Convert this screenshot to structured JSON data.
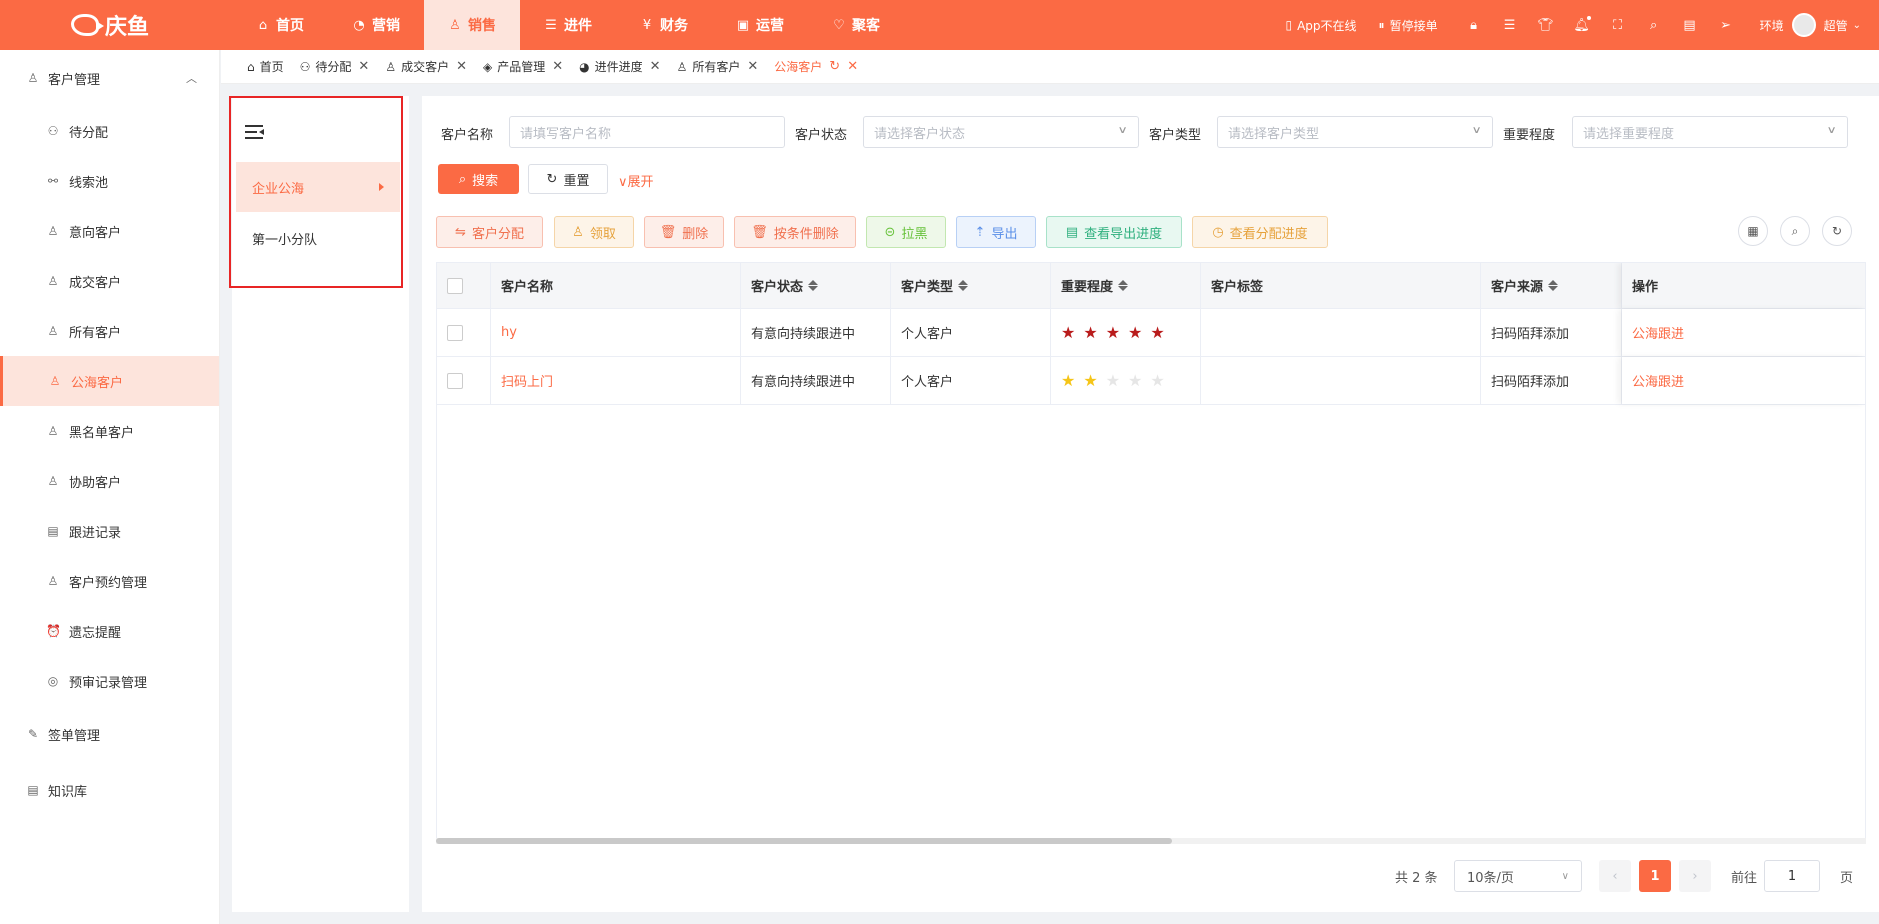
{
  "app": {
    "logo_text": "庆鱼"
  },
  "colors": {
    "accent": "#fb6a44",
    "star_red": "#b91c1c",
    "star_yellow": "#f5c518",
    "star_empty": "#e6e6e6"
  },
  "topnav": [
    {
      "label": "首页",
      "icon": "home-icon",
      "glyph": "⌂"
    },
    {
      "label": "营销",
      "icon": "marketing-icon",
      "glyph": "◔"
    },
    {
      "label": "销售",
      "icon": "sales-icon",
      "glyph": "♙",
      "active": true
    },
    {
      "label": "进件",
      "icon": "intake-icon",
      "glyph": "☰"
    },
    {
      "label": "财务",
      "icon": "finance-icon",
      "glyph": "¥"
    },
    {
      "label": "运营",
      "icon": "operations-icon",
      "glyph": "▣"
    },
    {
      "label": "聚客",
      "icon": "customers-icon",
      "glyph": "♡"
    }
  ],
  "topright": {
    "app_status": "App不在线",
    "pause": "暂停接单",
    "env": "环境",
    "user": "超管"
  },
  "sidebar": {
    "group1": "客户管理",
    "items": [
      {
        "label": "待分配",
        "icon": "sitemap-icon",
        "glyph": "⚇"
      },
      {
        "label": "线索池",
        "icon": "clue-icon",
        "glyph": "⚯"
      },
      {
        "label": "意向客户",
        "icon": "user-intent-icon",
        "glyph": "♙"
      },
      {
        "label": "成交客户",
        "icon": "user-deal-icon",
        "glyph": "♙"
      },
      {
        "label": "所有客户",
        "icon": "users-icon",
        "glyph": "♙"
      },
      {
        "label": "公海客户",
        "icon": "user-sea-icon",
        "glyph": "♙",
        "active": true
      },
      {
        "label": "黑名单客户",
        "icon": "user-block-icon",
        "glyph": "♙"
      },
      {
        "label": "协助客户",
        "icon": "user-assist-icon",
        "glyph": "♙"
      },
      {
        "label": "跟进记录",
        "icon": "record-icon",
        "glyph": "▤"
      },
      {
        "label": "客户预约管理",
        "icon": "appointment-icon",
        "glyph": "♙"
      },
      {
        "label": "遗忘提醒",
        "icon": "alarm-icon",
        "glyph": "⏰"
      },
      {
        "label": "预审记录管理",
        "icon": "review-icon",
        "glyph": "◎"
      }
    ],
    "group2": "签单管理",
    "group3": "知识库"
  },
  "tabs": [
    {
      "label": "首页",
      "icon": "home-icon",
      "glyph": "⌂",
      "closable": false
    },
    {
      "label": "待分配",
      "icon": "sitemap-icon",
      "glyph": "⚇",
      "closable": true
    },
    {
      "label": "成交客户",
      "icon": "user-icon",
      "glyph": "♙",
      "closable": true
    },
    {
      "label": "产品管理",
      "icon": "layers-icon",
      "glyph": "◈",
      "closable": true
    },
    {
      "label": "进件进度",
      "icon": "pie-icon",
      "glyph": "◕",
      "closable": true
    },
    {
      "label": "所有客户",
      "icon": "users-icon",
      "glyph": "♙",
      "closable": true
    },
    {
      "label": "公海客户",
      "icon": "",
      "glyph": "",
      "closable": true,
      "active": true
    }
  ],
  "groups": {
    "items": [
      "企业公海",
      "第一小分队"
    ]
  },
  "filters": {
    "name_label": "客户名称",
    "name_placeholder": "请填写客户名称",
    "status_label": "客户状态",
    "status_placeholder": "请选择客户状态",
    "type_label": "客户类型",
    "type_placeholder": "请选择客户类型",
    "level_label": "重要程度",
    "level_placeholder": "请选择重要程度",
    "search": "搜索",
    "reset": "重置",
    "expand": "展开"
  },
  "actions": {
    "assign": "客户分配",
    "claim": "领取",
    "delete": "删除",
    "cond_delete": "按条件删除",
    "blacklist": "拉黑",
    "export": "导出",
    "export_progress": "查看导出进度",
    "assign_progress": "查看分配进度"
  },
  "table": {
    "columns": [
      "客户名称",
      "客户状态",
      "客户类型",
      "重要程度",
      "客户标签",
      "客户来源",
      "操作"
    ],
    "rows": [
      {
        "name": "hy",
        "status": "有意向持续跟进中",
        "type": "个人客户",
        "stars": 5,
        "star_color": "red",
        "tag": "",
        "source": "扫码陌拜添加",
        "action": "公海跟进"
      },
      {
        "name": "扫码上门",
        "status": "有意向持续跟进中",
        "type": "个人客户",
        "stars": 2,
        "star_color": "yellow",
        "tag": "",
        "source": "扫码陌拜添加",
        "action": "公海跟进"
      }
    ]
  },
  "pagination": {
    "total": "共 2 条",
    "page_size": "10条/页",
    "current": "1",
    "goto_label": "前往",
    "goto_value": "1",
    "page_unit": "页"
  }
}
